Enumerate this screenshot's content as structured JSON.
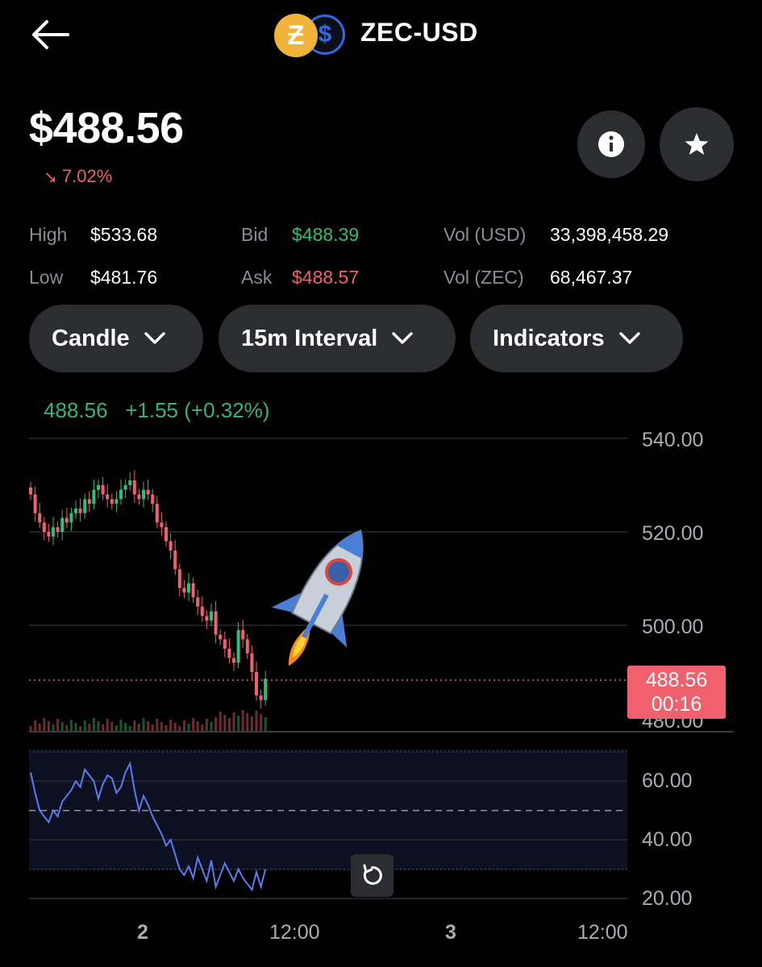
{
  "header": {
    "pair": "ZEC-USD",
    "base_symbol": "Ƶ",
    "quote_symbol": "$",
    "back_icon": "back-arrow-icon"
  },
  "price": {
    "current": "$488.56",
    "change": "7.02%",
    "direction": "down"
  },
  "stats": {
    "high_label": "High",
    "high": "$533.68",
    "low_label": "Low",
    "low": "$481.76",
    "bid_label": "Bid",
    "bid": "$488.39",
    "ask_label": "Ask",
    "ask": "$488.57",
    "vol_usd_label": "Vol (USD)",
    "vol_usd": "33,398,458.29",
    "vol_zec_label": "Vol (ZEC)",
    "vol_zec": "68,467.37"
  },
  "controls": {
    "chart_type": "Candle",
    "interval": "15m Interval",
    "indicators": "Indicators"
  },
  "quote_line": {
    "last": "488.56",
    "change": "+1.55",
    "change_pct": "(+0.32%)"
  },
  "price_axis": [
    "540.00",
    "520.00",
    "500.00",
    "480.00"
  ],
  "price_tag": {
    "value": "488.56",
    "countdown": "00:16"
  },
  "indicator_axis": [
    "60.00",
    "40.00",
    "20.00"
  ],
  "time_axis": [
    "2",
    "12:00",
    "3",
    "12:00"
  ],
  "colors": {
    "up": "#28c07a",
    "down": "#f0616d",
    "background": "#000000",
    "rsi": "#5b7cf0",
    "button": "#2b2d31"
  },
  "chart_data": {
    "type": "candlestick",
    "ylim": [
      480,
      540
    ],
    "closes": [
      528,
      524,
      522,
      520,
      519,
      521,
      520,
      523,
      522,
      524,
      525,
      524,
      527,
      526,
      529,
      530,
      528,
      527,
      526,
      527,
      529,
      530,
      531,
      528,
      527,
      529,
      528,
      526,
      522,
      521,
      518,
      516,
      512,
      508,
      507,
      509,
      506,
      504,
      502,
      501,
      503,
      498,
      497,
      495,
      493,
      492,
      499,
      497,
      494,
      490,
      485,
      484,
      488.56
    ],
    "rsi": [
      63,
      56,
      50,
      48,
      46,
      50,
      48,
      53,
      55,
      57,
      60,
      58,
      64,
      62,
      60,
      54,
      59,
      62,
      61,
      56,
      58,
      63,
      66,
      57,
      50,
      55,
      52,
      48,
      45,
      42,
      38,
      40,
      35,
      30,
      28,
      31,
      27,
      34,
      30,
      26,
      33,
      24,
      28,
      32,
      29,
      26,
      30,
      27,
      25,
      23,
      29,
      24,
      30
    ],
    "rsi_ylim": [
      20,
      70
    ],
    "time_labels": [
      "2",
      "12:00",
      "3",
      "12:00"
    ]
  }
}
